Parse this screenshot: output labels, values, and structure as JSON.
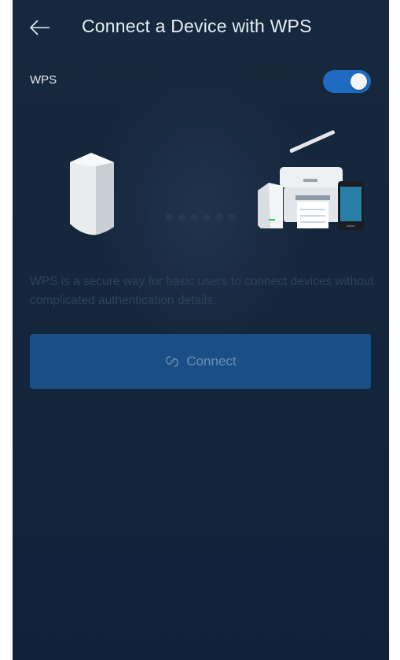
{
  "header": {
    "title": "Connect a Device with WPS",
    "back_icon": "arrow-left-icon"
  },
  "wps": {
    "label": "WPS",
    "enabled": true
  },
  "illustration": {
    "left_icon": "mesh-router-icon",
    "middle_icon": "connection-dots-icon",
    "right_icon": "devices-group-icon"
  },
  "description": "WPS is a secure way for basic users to connect devices without complicated authentication details.",
  "connect_button": {
    "label": "Connect",
    "icon": "link-icon"
  },
  "colors": {
    "background": "#14263b",
    "accent": "#1f6bc2",
    "button": "#1a4f85"
  }
}
